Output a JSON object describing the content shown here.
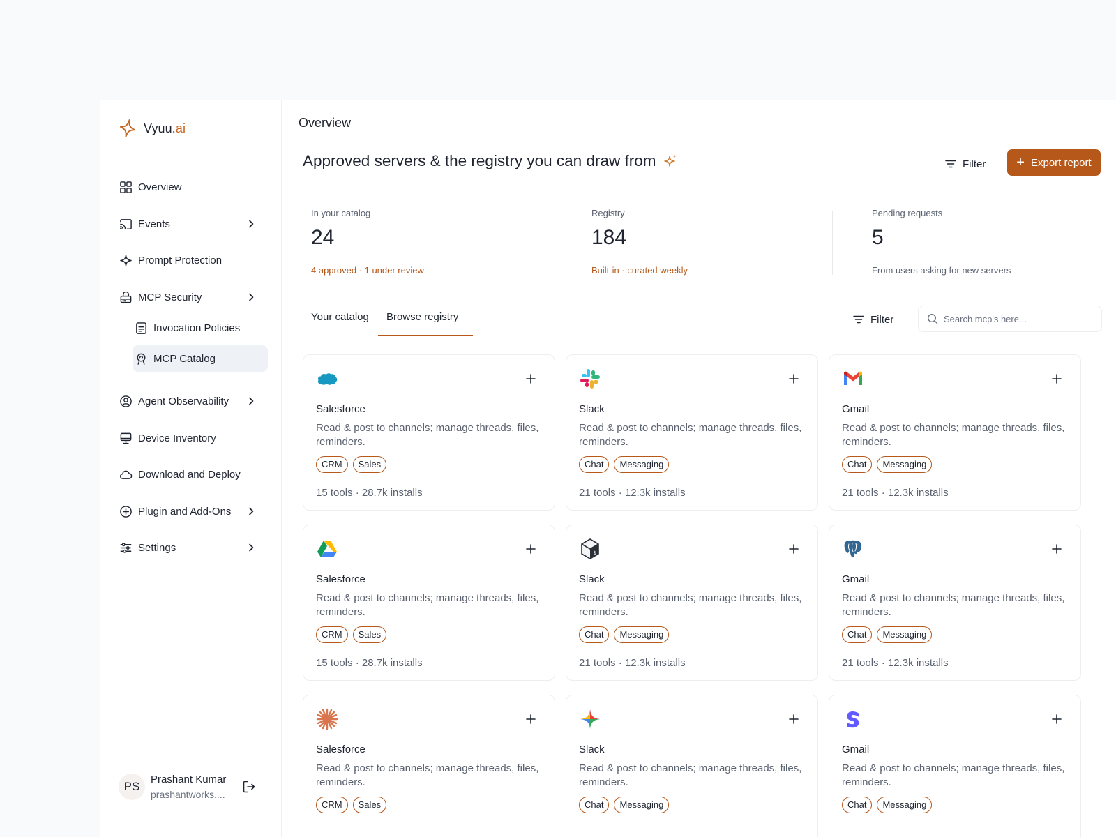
{
  "brand": {
    "name": "Vyuu.",
    "suffix": "ai",
    "accent": "#b5581a"
  },
  "sidebar": {
    "items": [
      {
        "label": "Overview",
        "icon": "grid-icon"
      },
      {
        "label": "Events",
        "icon": "cast-icon"
      },
      {
        "label": "Prompt Protection",
        "icon": "sparkle-icon"
      },
      {
        "label": "MCP Security",
        "icon": "lock-server-icon"
      },
      {
        "label": "Invocation Policies",
        "icon": "policy-doc-icon"
      },
      {
        "label": "MCP Catalog",
        "icon": "catalog-icon"
      },
      {
        "label": "Agent Observability",
        "icon": "user-circle-icon"
      },
      {
        "label": "Device Inventory",
        "icon": "monitor-icon"
      },
      {
        "label": "Download and Deploy",
        "icon": "cloud-icon"
      },
      {
        "label": "Plugin and Add-Ons",
        "icon": "plus-circle-icon"
      },
      {
        "label": "Settings",
        "icon": "sliders-icon"
      }
    ]
  },
  "user": {
    "initials": "PS",
    "name": "Prashant Kumar",
    "email": "prashantworks...."
  },
  "main": {
    "page_title": "Overview",
    "headline": "Approved servers & the registry you can draw from",
    "filter_label": "Filter",
    "export_label": "Export report"
  },
  "stats": [
    {
      "label": "In your catalog",
      "value": "24",
      "sub": "4 approved · 1 under review"
    },
    {
      "label": "Registry",
      "value": "184",
      "sub": "Built-in · curated weekly"
    },
    {
      "label": "Pending requests",
      "value": "5",
      "sub": "From users asking for new servers"
    }
  ],
  "tabs": [
    {
      "label": "Your catalog",
      "active": false
    },
    {
      "label": "Browse registry",
      "active": true
    }
  ],
  "list_filter_label": "Filter",
  "search": {
    "placeholder": "Search mcp's here...",
    "value": ""
  },
  "cards": [
    {
      "logo": "salesforce-logo",
      "name": "Salesforce",
      "desc": "Read & post to channels; manage threads, files, reminders.",
      "tags": [
        "CRM",
        "Sales"
      ],
      "meta": "15 tools · 28.7k installs"
    },
    {
      "logo": "slack-logo",
      "name": "Slack",
      "desc": "Read & post to channels; manage threads, files, reminders.",
      "tags": [
        "Chat",
        "Messaging"
      ],
      "meta": "21 tools · 12.3k installs"
    },
    {
      "logo": "gmail-logo",
      "name": "Gmail",
      "desc": "Read & post to channels; manage threads, files, reminders.",
      "tags": [
        "Chat",
        "Messaging"
      ],
      "meta": "21 tools · 12.3k installs"
    },
    {
      "logo": "google-drive-logo",
      "name": "Salesforce",
      "desc": "Read & post to channels; manage threads, files, reminders.",
      "tags": [
        "CRM",
        "Sales"
      ],
      "meta": "15 tools · 28.7k installs"
    },
    {
      "logo": "terminal-box-logo",
      "name": "Slack",
      "desc": "Read & post to channels; manage threads, files, reminders.",
      "tags": [
        "Chat",
        "Messaging"
      ],
      "meta": "21 tools · 12.3k installs"
    },
    {
      "logo": "postgres-logo",
      "name": "Gmail",
      "desc": "Read & post to channels; manage threads, files, reminders.",
      "tags": [
        "Chat",
        "Messaging"
      ],
      "meta": "21 tools · 12.3k installs"
    },
    {
      "logo": "claude-starburst-logo",
      "name": "Salesforce",
      "desc": "Read & post to channels; manage threads, files, reminders.",
      "tags": [
        "CRM",
        "Sales"
      ],
      "meta": ""
    },
    {
      "logo": "gemini-star-logo",
      "name": "Slack",
      "desc": "Read & post to channels; manage threads, files, reminders.",
      "tags": [
        "Chat",
        "Messaging"
      ],
      "meta": ""
    },
    {
      "logo": "stripe-logo",
      "name": "Gmail",
      "desc": "Read & post to channels; manage threads, files, reminders.",
      "tags": [
        "Chat",
        "Messaging"
      ],
      "meta": ""
    }
  ]
}
